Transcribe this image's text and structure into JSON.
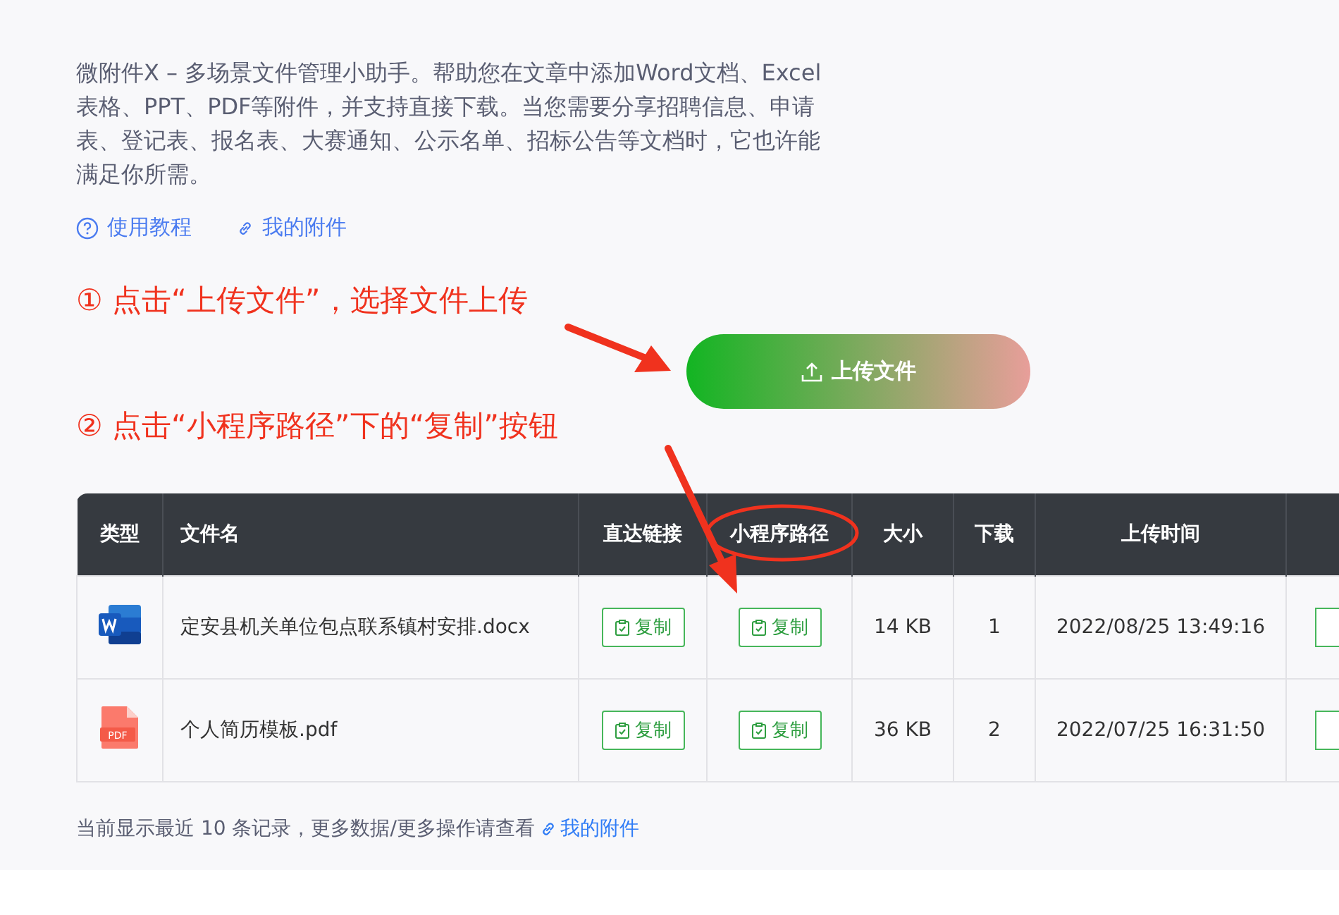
{
  "intro": {
    "text": "微附件X – 多场景文件管理小助手。帮助您在文章中添加Word文档、Excel表格、PPT、PDF等附件，并支持直接下载。当您需要分享招聘信息、申请表、登记表、报名表、大赛通知、公示名单、招标公告等文档时，它也许能满足你所需。"
  },
  "links": [
    {
      "kind": "help",
      "label": "使用教程"
    },
    {
      "kind": "link",
      "label": "我的附件"
    }
  ],
  "steps": [
    {
      "text": "① 点击“上传文件”，选择文件上传"
    },
    {
      "text": "② 点击“小程序路径”下的“复制”按钮"
    }
  ],
  "upload_button": {
    "label": "上传文件"
  },
  "table": {
    "columns": [
      "类型",
      "文件名",
      "直达链接",
      "小程序路径",
      "大小",
      "下载",
      "上传时间"
    ],
    "rows": [
      {
        "kind": "word",
        "name": "定安县机关单位包点联系镇村安排.docx",
        "direct_link": "复制",
        "mini_path": "复制",
        "size": "14 KB",
        "downloads": "1",
        "uploaded": "2022/08/25 13:49:16"
      },
      {
        "kind": "pdf",
        "icon_label": "PDF",
        "name": "个人简历模板.pdf",
        "direct_link": "复制",
        "mini_path": "复制",
        "size": "36 KB",
        "downloads": "2",
        "uploaded": "2022/07/25 16:31:50"
      }
    ]
  },
  "footer": {
    "text": "当前显示最近 10 条记录，更多数据/更多操作请查看",
    "link": "我的附件"
  }
}
